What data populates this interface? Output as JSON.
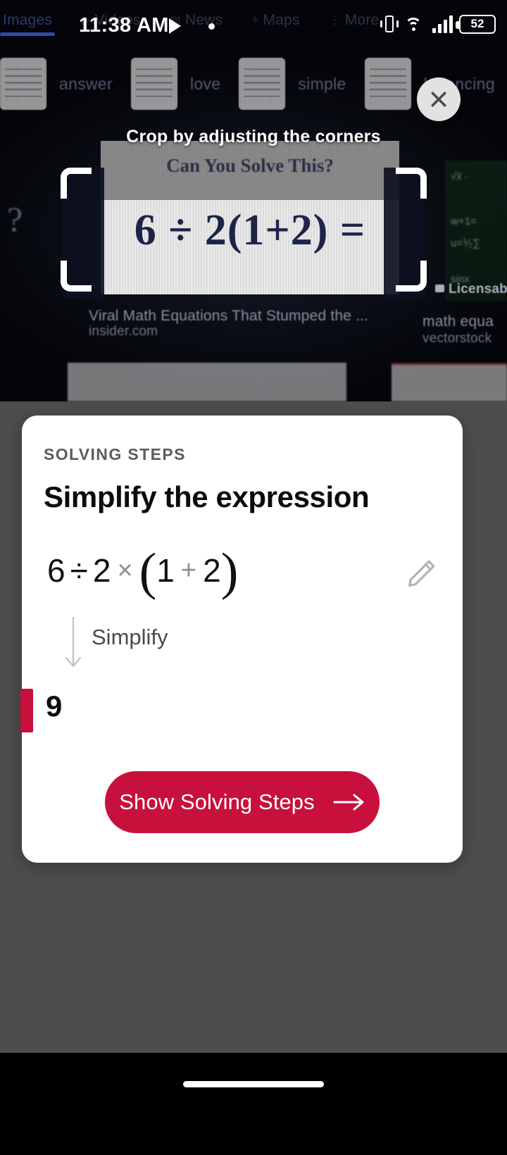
{
  "status_bar": {
    "time": "11:38 AM",
    "media_icon": "play-triangle-icon",
    "recording_dot": "recording-dot-icon",
    "vibrate_icon": "vibrate-icon",
    "wifi_icon": "wifi-icon",
    "signal_icon": "cellular-signal-icon",
    "battery_level": "52"
  },
  "backdrop": {
    "search_tabs": [
      {
        "label": "Images",
        "active": true,
        "icon": ""
      },
      {
        "label": "Videos",
        "active": false,
        "icon": "▶"
      },
      {
        "label": "News",
        "active": false,
        "icon": "▤"
      },
      {
        "label": "Maps",
        "active": false,
        "icon": "⌖"
      },
      {
        "label": "More",
        "active": false,
        "icon": "⋮"
      }
    ],
    "filter_chips": [
      "answer",
      "love",
      "simple",
      "balancing"
    ],
    "crop_hint": "Crop by adjusting the corners",
    "paper_title": "Can You Solve This?",
    "paper_equation": "6 ÷ 2(1+2) =",
    "result_caption_title": "Viral Math Equations That Stumped the ...",
    "result_caption_source": "insider.com",
    "result_right_title": "math equa",
    "result_right_source": "vectorstock",
    "licensable_label": "Licensab",
    "close_icon": "close-x-icon"
  },
  "card": {
    "eyebrow": "SOLVING STEPS",
    "title": "Simplify the expression",
    "expression": {
      "full_text": "6 ÷ 2 × (1 + 2)",
      "tokens": [
        {
          "t": "6",
          "kind": "num"
        },
        {
          "t": "÷",
          "kind": "op"
        },
        {
          "t": "2",
          "kind": "num"
        },
        {
          "t": "×",
          "kind": "opg"
        },
        {
          "t": "(",
          "kind": "paren"
        },
        {
          "t": "1",
          "kind": "num"
        },
        {
          "t": "+",
          "kind": "opg"
        },
        {
          "t": "2",
          "kind": "num"
        },
        {
          "t": ")",
          "kind": "paren"
        }
      ]
    },
    "edit_icon": "pencil-edit-icon",
    "step_arrow_icon": "down-arrow-icon",
    "step_label": "Simplify",
    "result_value": "9",
    "cta": {
      "label": "Show Solving Steps",
      "arrow_icon": "right-arrow-icon"
    }
  },
  "colors": {
    "accent_red": "#c8103c",
    "scrim_gray": "#4d4d4d",
    "card_white": "#ffffff",
    "eyebrow_gray": "#5c5c5c",
    "muted_gray": "#8f8f8f",
    "tab_blue": "#4d6ecf"
  },
  "navigation_bar": {
    "home_indicator": "home-indicator"
  }
}
